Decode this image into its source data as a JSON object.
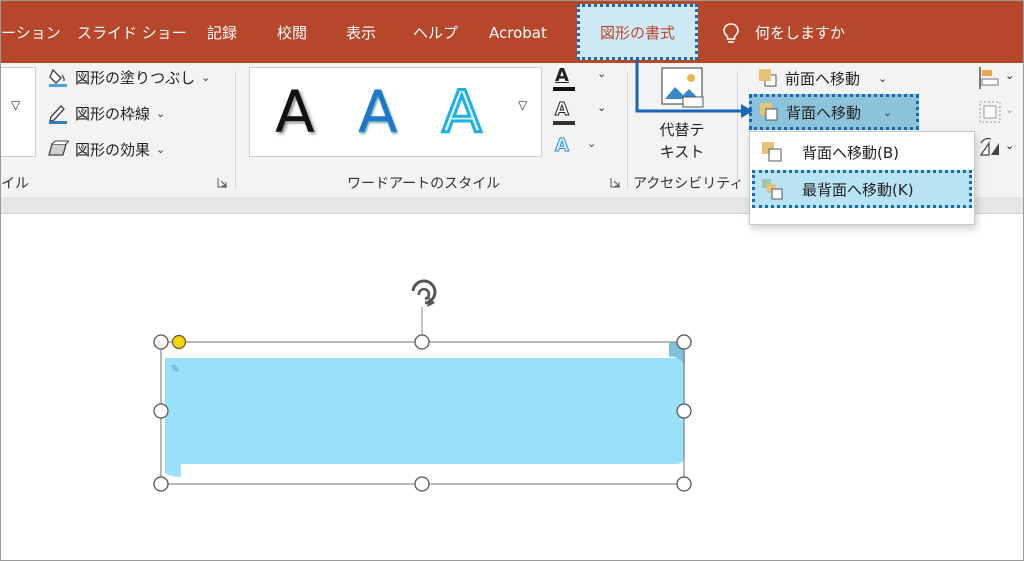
{
  "tabs": {
    "slideshow_partial": "ーション",
    "slideshow": "スライド ショー",
    "record": "記録",
    "review": "校閲",
    "view": "表示",
    "help": "ヘルプ",
    "acrobat": "Acrobat",
    "shape_format": "図形の書式",
    "tell_me": "何をしますか"
  },
  "shape_styles": {
    "fill": "図形の塗りつぶし",
    "outline": "図形の枠線",
    "effects": "図形の効果",
    "group_label_partial": "イル"
  },
  "wordart": {
    "sample_letter": "A",
    "group_label": "ワードアートのスタイル",
    "text_fill_letter": "A",
    "text_outline_letter": "A",
    "text_effects_letter": "A"
  },
  "accessibility": {
    "alt_text_line1": "代替テ",
    "alt_text_line2": "キスト",
    "group_label": "アクセシビリティ"
  },
  "arrange": {
    "bring_forward": "前面へ移動",
    "send_backward": "背面へ移動",
    "menu": {
      "send_backward_item": "背面へ移動(B)",
      "send_to_back_item": "最背面へ移動(K)"
    }
  },
  "colors": {
    "accent": "#b7472a",
    "highlight_border": "#1a66b8",
    "shape_fill": "#99e0fb"
  }
}
